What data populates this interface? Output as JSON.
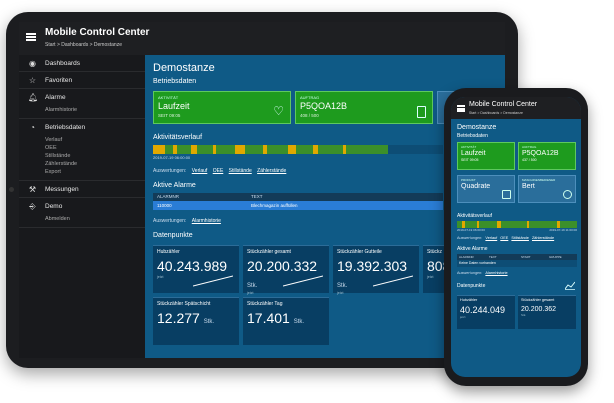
{
  "app": {
    "title": "Mobile Control Center",
    "breadcrumb": "Start  >  Dashboards  >  Demostanze"
  },
  "sidebar": {
    "items": [
      {
        "label": "Dashboards",
        "icon": "eye-icon",
        "subs": []
      },
      {
        "label": "Favoriten",
        "icon": "star-icon",
        "subs": []
      },
      {
        "label": "Alarme",
        "icon": "bell-icon",
        "subs": [
          "Alarmhistorie"
        ]
      },
      {
        "label": "Betriebsdaten",
        "icon": "pie-chart-icon",
        "subs": [
          "Verlauf",
          "OEE",
          "Stillstände",
          "Zählerstände",
          "Export"
        ]
      },
      {
        "label": "Messungen",
        "icon": "wrench-icon",
        "subs": []
      },
      {
        "label": "Demo",
        "icon": "exit-icon",
        "subs": [
          "Abmelden"
        ]
      }
    ]
  },
  "main": {
    "title": "Demostanze",
    "subtitle": "Betriebsdaten",
    "cards": [
      {
        "label": "Aktivität",
        "value": "Laufzeit",
        "sub": "SEIT 09:05",
        "color": "#1e9b1e"
      },
      {
        "label": "Auftrag",
        "value": "P5QOA12B",
        "sub": "408 / 500",
        "color": "#1e9b1e"
      }
    ],
    "activity_title": "Aktivitätsverlauf",
    "activity_time": "2019-07-19 06:00:00",
    "auswertungen_label": "Auswertungen:",
    "auswertungen_links": [
      "Verlauf",
      "OEE",
      "Stillstände",
      "Zählerstände"
    ],
    "alarms_title": "Aktive Alarme",
    "alarm_headers": [
      "ALARMNR",
      "TEXT"
    ],
    "alarm_rows": [
      {
        "nr": "110000",
        "text": "Blechmagazin auffüllen"
      }
    ],
    "alarm_links": [
      "Alarmhistorie"
    ],
    "datapoints_title": "Datenpunkte",
    "datapoints": [
      {
        "label": "Hubzähler",
        "value": "40.243.989",
        "unit": "",
        "sub": "jetzt"
      },
      {
        "label": "Stückzähler gesamt",
        "value": "20.200.332",
        "unit": "Stk.",
        "sub": "jetzt"
      },
      {
        "label": "Stückzähler Gutteile",
        "value": "19.392.303",
        "unit": "Stk.",
        "sub": "jetzt"
      },
      {
        "label": "Stückz",
        "value": "808",
        "unit": "",
        "sub": "jetzt"
      },
      {
        "label": "Stückzähler Spätschicht",
        "value": "12.277",
        "unit": "Stk.",
        "sub": ""
      },
      {
        "label": "Stückzähler Tag",
        "value": "17.401",
        "unit": "Stk.",
        "sub": ""
      }
    ]
  },
  "phone": {
    "title": "Mobile Control Center",
    "breadcrumb": "Start  >  Dashboards  >  Demostanze",
    "page_title": "Demostanze",
    "subtitle": "Betriebsdaten",
    "cards": [
      {
        "label": "Aktivität",
        "value": "Laufzeit",
        "sub": "SEIT 09:05"
      },
      {
        "label": "Auftrag",
        "value": "P5QOA12B",
        "sub": "437 / 500"
      },
      {
        "label": "Produkt",
        "value": "Quadrate",
        "sub": ""
      },
      {
        "label": "Maschinenbediener",
        "value": "Bert",
        "sub": ""
      }
    ],
    "activity_title": "Aktivitätsverlauf",
    "activity_time_left": "2019-07-19 06:00:00",
    "activity_time_right": "2019-07-19 11:00:00",
    "auswertungen_label": "Auswertungen:",
    "auswertungen_links": [
      "Verlauf",
      "OEE",
      "Stillstände",
      "Zählerstände"
    ],
    "alarms_title": "Aktive Alarme",
    "alarm_headers": [
      "ALARMNR",
      "TEXT",
      "START",
      "GRUPPE"
    ],
    "alarm_empty": "Keine Daten vorhanden",
    "alarm_links": [
      "Alarmhistorie"
    ],
    "datapoints_title": "Datenpunkte",
    "datapoints": [
      {
        "label": "Hubzähler",
        "value": "40.244.049",
        "sub": "jetzt"
      },
      {
        "label": "Stückzähler gesamt",
        "value": "20.200.362",
        "sub": "Stk."
      }
    ]
  }
}
